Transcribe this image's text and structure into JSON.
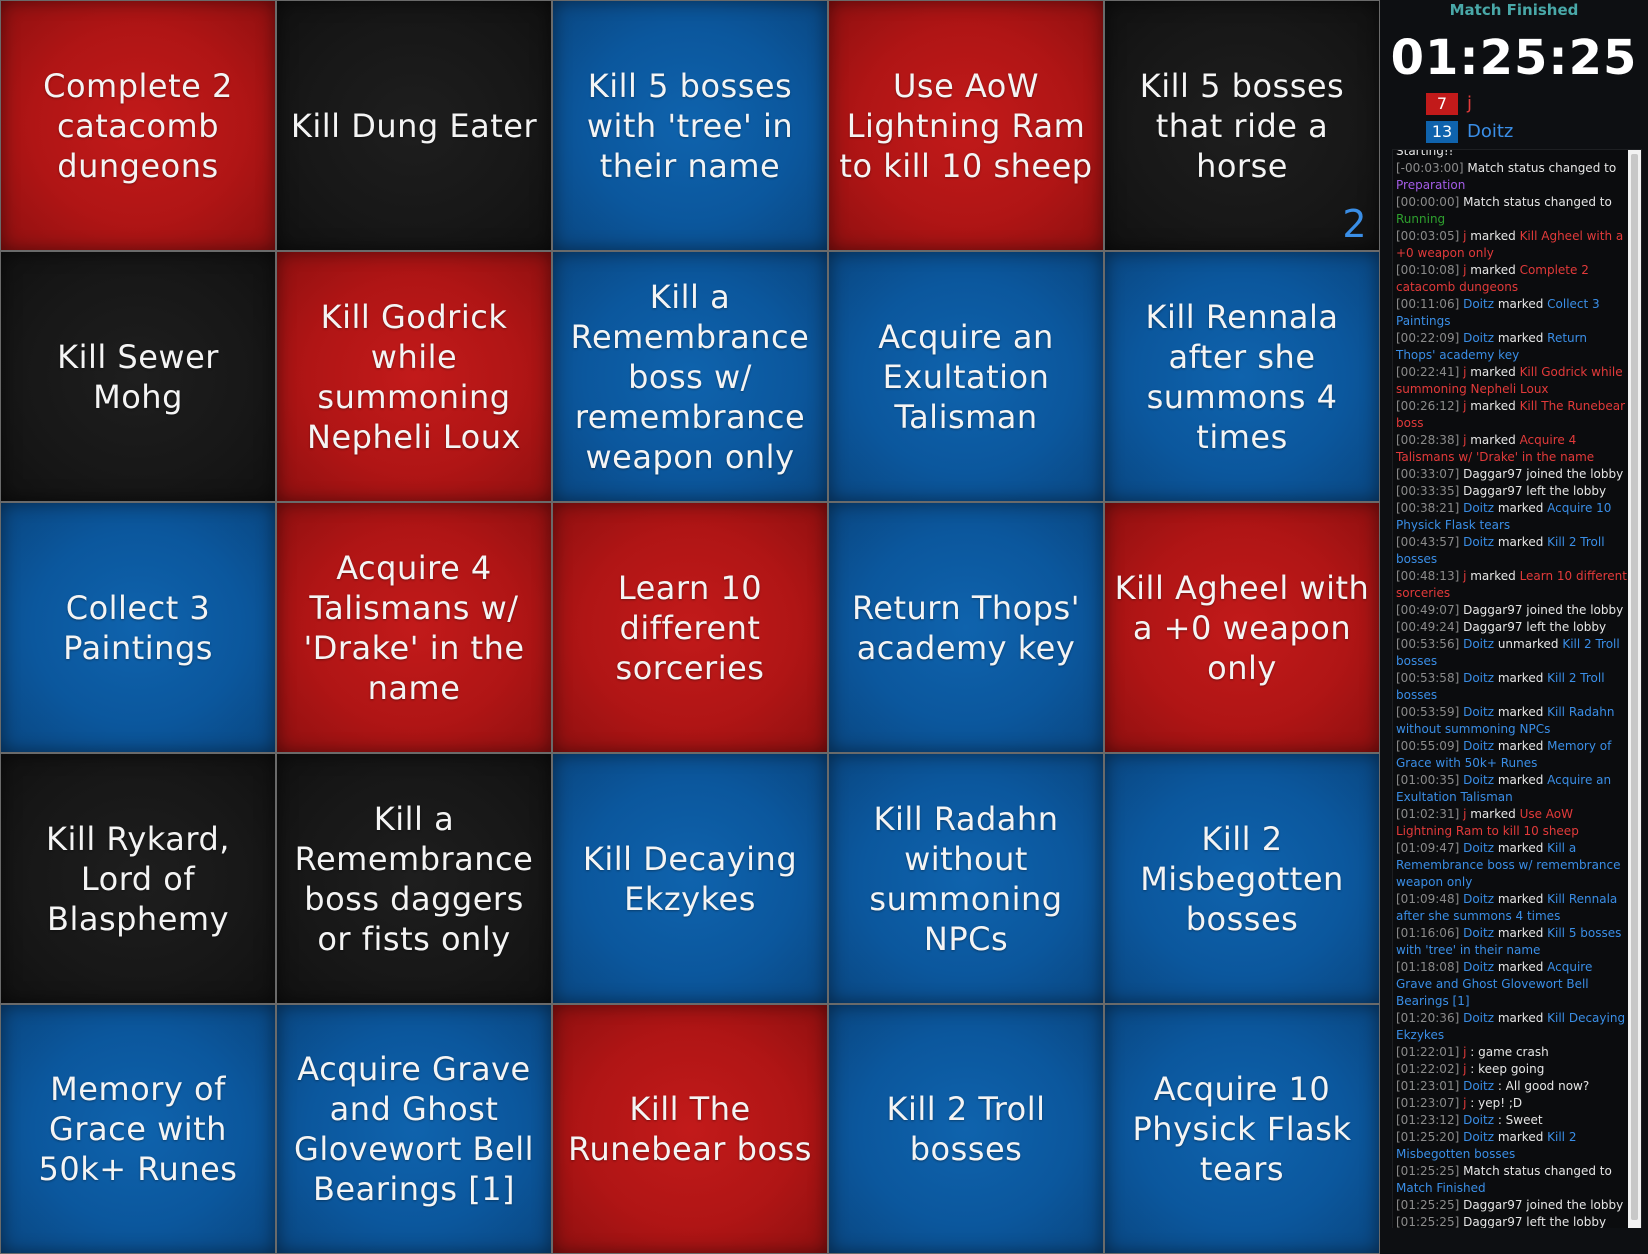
{
  "board": {
    "cells": [
      {
        "text": "Complete 2 catacomb dungeons",
        "team": "red"
      },
      {
        "text": "Kill Dung Eater",
        "team": "black"
      },
      {
        "text": "Kill 5 bosses with 'tree' in their name",
        "team": "blue"
      },
      {
        "text": "Use AoW Lightning Ram to kill 10 sheep",
        "team": "red"
      },
      {
        "text": "Kill 5 bosses that ride a horse",
        "team": "black",
        "counter": "2"
      },
      {
        "text": "Kill Sewer Mohg",
        "team": "black"
      },
      {
        "text": "Kill Godrick while summoning Nepheli Loux",
        "team": "red"
      },
      {
        "text": "Kill a Remembrance boss w/ remembrance weapon only",
        "team": "blue"
      },
      {
        "text": "Acquire an Exultation Talisman",
        "team": "blue"
      },
      {
        "text": "Kill Rennala after she summons 4 times",
        "team": "blue"
      },
      {
        "text": "Collect 3 Paintings",
        "team": "blue"
      },
      {
        "text": "Acquire 4 Talismans w/ 'Drake' in the name",
        "team": "red"
      },
      {
        "text": "Learn 10 different sorceries",
        "team": "red"
      },
      {
        "text": "Return Thops' academy key",
        "team": "blue"
      },
      {
        "text": "Kill Agheel with a +0 weapon only",
        "team": "red"
      },
      {
        "text": "Kill Rykard, Lord of Blasphemy",
        "team": "black"
      },
      {
        "text": "Kill a Remembrance boss daggers or fists only",
        "team": "black"
      },
      {
        "text": "Kill Decaying Ekzykes",
        "team": "blue"
      },
      {
        "text": "Kill Radahn without summoning NPCs",
        "team": "blue"
      },
      {
        "text": "Kill 2 Misbegotten bosses",
        "team": "blue"
      },
      {
        "text": "Memory of Grace with 50k+ Runes",
        "team": "blue"
      },
      {
        "text": "Acquire Grave and Ghost Glovewort Bell Bearings [1]",
        "team": "blue"
      },
      {
        "text": "Kill The Runebear boss",
        "team": "red"
      },
      {
        "text": "Kill 2 Troll bosses",
        "team": "blue"
      },
      {
        "text": "Acquire 10 Physick Flask tears",
        "team": "blue"
      }
    ]
  },
  "side": {
    "status": "Match Finished",
    "timer": "01:25:25",
    "teams": [
      {
        "score": "7",
        "name": "j",
        "color": "#c21a1a"
      },
      {
        "score": "13",
        "name": "Doitz",
        "color": "#0f63ad"
      }
    ]
  },
  "log": [
    [
      [
        "",
        "Starting!!"
      ]
    ],
    [
      [
        "ts",
        "[-00:03:00]"
      ],
      [
        "",
        " Match status changed to "
      ],
      [
        "purple",
        "Preparation"
      ]
    ],
    [
      [
        "ts",
        "[00:00:00]"
      ],
      [
        "",
        " Match status changed to "
      ],
      [
        "green",
        "Running"
      ]
    ],
    [
      [
        "ts",
        "[00:03:05]"
      ],
      [
        "red",
        " j"
      ],
      [
        "",
        " marked "
      ],
      [
        "red",
        "Kill Agheel with a +0 weapon only"
      ]
    ],
    [
      [
        "ts",
        "[00:10:08]"
      ],
      [
        "red",
        " j"
      ],
      [
        "",
        " marked "
      ],
      [
        "red",
        "Complete 2 catacomb dungeons"
      ]
    ],
    [
      [
        "ts",
        "[00:11:06]"
      ],
      [
        "blue",
        " Doitz"
      ],
      [
        "",
        " marked "
      ],
      [
        "blue",
        "Collect 3 Paintings"
      ]
    ],
    [
      [
        "ts",
        "[00:22:09]"
      ],
      [
        "blue",
        " Doitz"
      ],
      [
        "",
        " marked "
      ],
      [
        "blue",
        "Return Thops' academy key"
      ]
    ],
    [
      [
        "ts",
        "[00:22:41]"
      ],
      [
        "red",
        " j"
      ],
      [
        "",
        " marked "
      ],
      [
        "red",
        "Kill Godrick while summoning Nepheli Loux"
      ]
    ],
    [
      [
        "ts",
        "[00:26:12]"
      ],
      [
        "red",
        " j"
      ],
      [
        "",
        " marked "
      ],
      [
        "red",
        "Kill The Runebear boss"
      ]
    ],
    [
      [
        "ts",
        "[00:28:38]"
      ],
      [
        "red",
        " j"
      ],
      [
        "",
        " marked "
      ],
      [
        "red",
        "Acquire 4 Talismans w/ 'Drake' in the name"
      ]
    ],
    [
      [
        "ts",
        "[00:33:07]"
      ],
      [
        "",
        " Daggar97 joined the lobby"
      ]
    ],
    [
      [
        "ts",
        "[00:33:35]"
      ],
      [
        "",
        " Daggar97 left the lobby"
      ]
    ],
    [
      [
        "ts",
        "[00:38:21]"
      ],
      [
        "blue",
        " Doitz"
      ],
      [
        "",
        " marked "
      ],
      [
        "blue",
        "Acquire 10 Physick Flask tears"
      ]
    ],
    [
      [
        "ts",
        "[00:43:57]"
      ],
      [
        "blue",
        " Doitz"
      ],
      [
        "",
        " marked "
      ],
      [
        "blue",
        "Kill 2 Troll bosses"
      ]
    ],
    [
      [
        "ts",
        "[00:48:13]"
      ],
      [
        "red",
        " j"
      ],
      [
        "",
        " marked "
      ],
      [
        "red",
        "Learn 10 different sorceries"
      ]
    ],
    [
      [
        "ts",
        "[00:49:07]"
      ],
      [
        "",
        " Daggar97 joined the lobby"
      ]
    ],
    [
      [
        "ts",
        "[00:49:24]"
      ],
      [
        "",
        " Daggar97 left the lobby"
      ]
    ],
    [
      [
        "ts",
        "[00:53:56]"
      ],
      [
        "blue",
        " Doitz"
      ],
      [
        "",
        " unmarked "
      ],
      [
        "blue",
        "Kill 2 Troll bosses"
      ]
    ],
    [
      [
        "ts",
        "[00:53:58]"
      ],
      [
        "blue",
        " Doitz"
      ],
      [
        "",
        " marked "
      ],
      [
        "blue",
        "Kill 2 Troll bosses"
      ]
    ],
    [
      [
        "ts",
        "[00:53:59]"
      ],
      [
        "blue",
        " Doitz"
      ],
      [
        "",
        " marked "
      ],
      [
        "blue",
        "Kill Radahn without summoning NPCs"
      ]
    ],
    [
      [
        "ts",
        "[00:55:09]"
      ],
      [
        "blue",
        " Doitz"
      ],
      [
        "",
        " marked "
      ],
      [
        "blue",
        "Memory of Grace with 50k+ Runes"
      ]
    ],
    [
      [
        "ts",
        "[01:00:35]"
      ],
      [
        "blue",
        " Doitz"
      ],
      [
        "",
        " marked "
      ],
      [
        "blue",
        "Acquire an Exultation Talisman"
      ]
    ],
    [
      [
        "ts",
        "[01:02:31]"
      ],
      [
        "red",
        " j"
      ],
      [
        "",
        " marked "
      ],
      [
        "red",
        "Use AoW Lightning Ram to kill 10 sheep"
      ]
    ],
    [
      [
        "ts",
        "[01:09:47]"
      ],
      [
        "blue",
        " Doitz"
      ],
      [
        "",
        " marked "
      ],
      [
        "blue",
        "Kill a Remembrance boss w/ remembrance weapon only"
      ]
    ],
    [
      [
        "ts",
        "[01:09:48]"
      ],
      [
        "blue",
        " Doitz"
      ],
      [
        "",
        " marked "
      ],
      [
        "blue",
        "Kill Rennala after she summons 4 times"
      ]
    ],
    [
      [
        "ts",
        "[01:16:06]"
      ],
      [
        "blue",
        " Doitz"
      ],
      [
        "",
        " marked "
      ],
      [
        "blue",
        "Kill 5 bosses with 'tree' in their name"
      ]
    ],
    [
      [
        "ts",
        "[01:18:08]"
      ],
      [
        "blue",
        " Doitz"
      ],
      [
        "",
        " marked "
      ],
      [
        "blue",
        "Acquire Grave and Ghost Glovewort Bell Bearings [1]"
      ]
    ],
    [
      [
        "ts",
        "[01:20:36]"
      ],
      [
        "blue",
        " Doitz"
      ],
      [
        "",
        " marked "
      ],
      [
        "blue",
        "Kill Decaying Ekzykes"
      ]
    ],
    [
      [
        "ts",
        "[01:22:01]"
      ],
      [
        "red",
        " j"
      ],
      [
        "",
        " : game crash"
      ]
    ],
    [
      [
        "ts",
        "[01:22:02]"
      ],
      [
        "red",
        " j"
      ],
      [
        "",
        " : keep going"
      ]
    ],
    [
      [
        "ts",
        "[01:23:01]"
      ],
      [
        "blue",
        " Doitz"
      ],
      [
        "",
        " : All good now?"
      ]
    ],
    [
      [
        "ts",
        "[01:23:07]"
      ],
      [
        "red",
        " j"
      ],
      [
        "",
        " : yep! ;D"
      ]
    ],
    [
      [
        "ts",
        "[01:23:12]"
      ],
      [
        "blue",
        " Doitz"
      ],
      [
        "",
        " : Sweet"
      ]
    ],
    [
      [
        "ts",
        "[01:25:20]"
      ],
      [
        "blue",
        " Doitz"
      ],
      [
        "",
        " marked "
      ],
      [
        "blue",
        "Kill 2 Misbegotten bosses"
      ]
    ],
    [
      [
        "ts",
        "[01:25:25]"
      ],
      [
        "",
        " Match status changed to "
      ],
      [
        "blue",
        "Match Finished"
      ]
    ],
    [
      [
        "ts",
        "[01:25:25]"
      ],
      [
        "",
        " Daggar97 joined the lobby"
      ]
    ],
    [
      [
        "ts",
        "[01:25:25]"
      ],
      [
        "",
        " Daggar97 left the lobby"
      ]
    ]
  ]
}
